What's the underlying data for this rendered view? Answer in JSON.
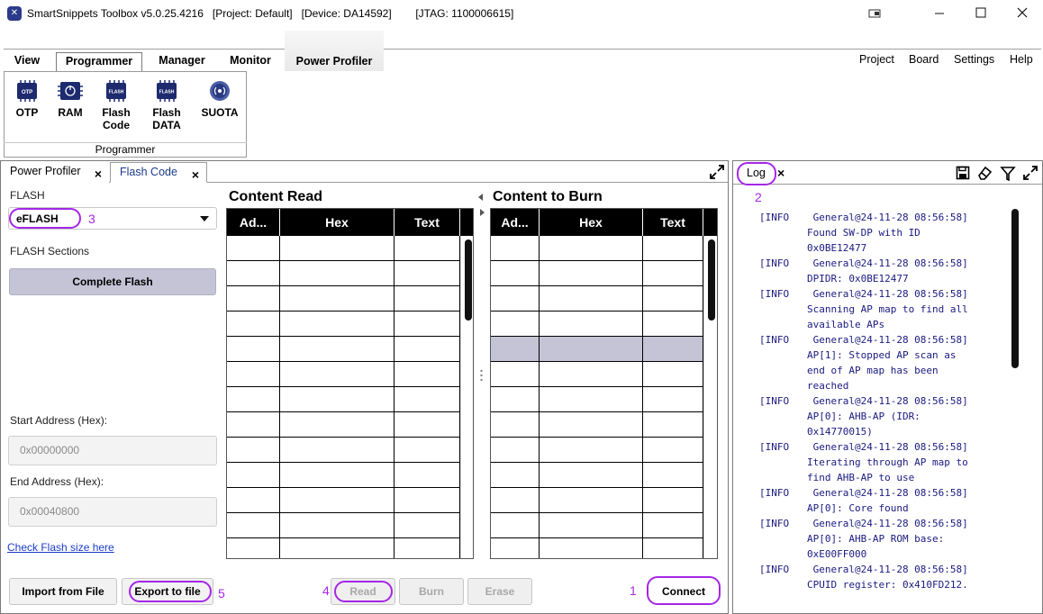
{
  "window": {
    "title": "SmartSnippets Toolbox v5.0.25.4216   [Project: Default]   [Device: DA14592]        [JTAG: 1100006615]"
  },
  "menu": {
    "tabs": [
      "View",
      "Programmer",
      "Manager",
      "Monitor",
      "Power Profiler"
    ],
    "right": [
      "Project",
      "Board",
      "Settings",
      "Help"
    ]
  },
  "ribbon": {
    "items": [
      {
        "label": "OTP",
        "icon": "otp-chip-icon"
      },
      {
        "label": "RAM",
        "icon": "ram-chip-icon"
      },
      {
        "label": "Flash\nCode",
        "icon": "flash-chip-icon"
      },
      {
        "label": "Flash\nDATA",
        "icon": "flash-chip-icon"
      },
      {
        "label": "SUOTA",
        "icon": "suota-icon"
      }
    ],
    "icon_text": {
      "otp": "OTP",
      "flash": "FLASH"
    },
    "group_label": "Programmer"
  },
  "doc_tabs": [
    {
      "label": "Power Profiler"
    },
    {
      "label": "Flash Code",
      "active": true
    }
  ],
  "close_glyph": "×",
  "left": {
    "flash_label": "FLASH",
    "flash_value": "eFLASH",
    "sections_label": "FLASH Sections",
    "complete_flash": "Complete Flash",
    "start_label": "Start Address (Hex):",
    "start_value": "0x00000000",
    "end_label": "End Address (Hex):",
    "end_value": "0x00040800",
    "check_link": "Check Flash size here"
  },
  "content_read": {
    "title": "Content Read",
    "columns": [
      "Ad...",
      "Hex",
      "Text"
    ]
  },
  "content_burn": {
    "title": "Content to Burn",
    "columns": [
      "Ad...",
      "Hex",
      "Text"
    ],
    "selected_row_index": 4
  },
  "buttons": {
    "import": "Import from File",
    "export": "Export to file",
    "read": "Read",
    "burn": "Burn",
    "erase": "Erase",
    "connect": "Connect"
  },
  "annotations": [
    "1",
    "2",
    "3",
    "4",
    "5"
  ],
  "log": {
    "title": "Log",
    "entries": [
      "[INFO    General@24-11-28 08:56:58]\n        Found SW-DP with ID\n        0x0BE12477",
      "[INFO    General@24-11-28 08:56:58]\n        DPIDR: 0x0BE12477",
      "[INFO    General@24-11-28 08:56:58]\n        Scanning AP map to find all\n        available APs",
      "[INFO    General@24-11-28 08:56:58]\n        AP[1]: Stopped AP scan as\n        end of AP map has been\n        reached",
      "[INFO    General@24-11-28 08:56:58]\n        AP[0]: AHB-AP (IDR:\n        0x14770015)",
      "[INFO    General@24-11-28 08:56:58]\n        Iterating through AP map to\n        find AHB-AP to use",
      "[INFO    General@24-11-28 08:56:58]\n        AP[0]: Core found",
      "[INFO    General@24-11-28 08:56:58]\n        AP[0]: AHB-AP ROM base:\n        0xE00FF000",
      "[INFO    General@24-11-28 08:56:58]\n        CPUID register: 0x410FD212."
    ]
  },
  "colors": {
    "highlight": "#a526e6",
    "selected_row": "#c4c4d6"
  }
}
